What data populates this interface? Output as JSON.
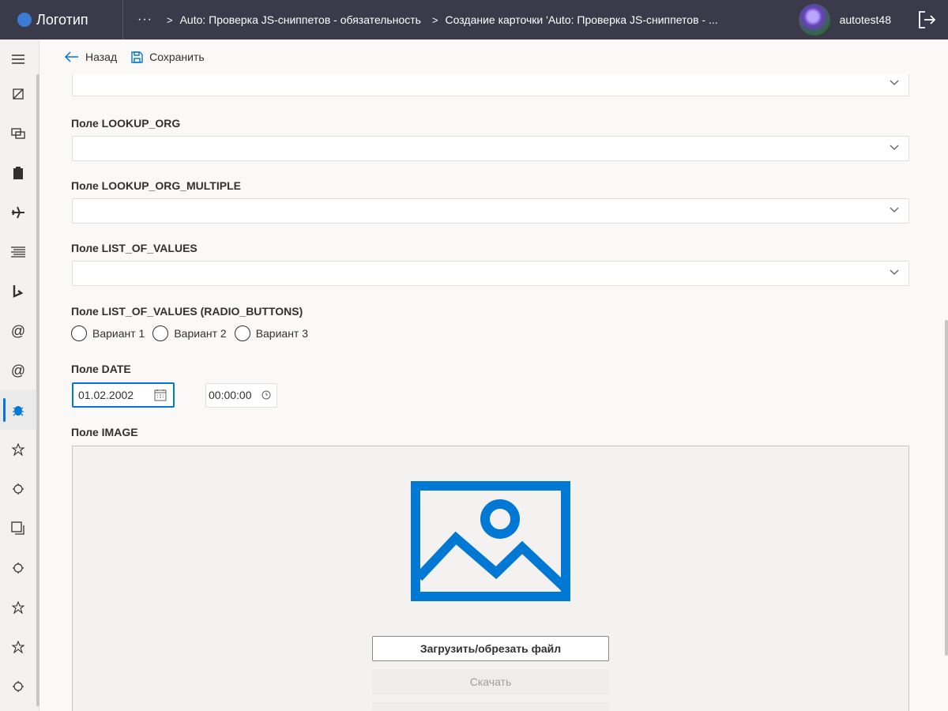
{
  "header": {
    "logo_text": "Логотип",
    "more": "···",
    "breadcrumbs": [
      "Auto: Проверка JS-сниппетов - обязательность",
      "Создание карточки 'Auto: Проверка JS-сниппетов - ..."
    ],
    "username": "autotest48"
  },
  "toolbar": {
    "back_label": "Назад",
    "save_label": "Сохранить"
  },
  "sidebar": {
    "icons": [
      "menu-icon",
      "document-icon",
      "chat-icon",
      "clipboard-icon",
      "airplane-icon",
      "list-icon",
      "bing-icon",
      "at-icon",
      "at-icon-2",
      "bug-icon",
      "star-icon",
      "gear-icon",
      "copy-icon",
      "gear-icon-2",
      "star-icon-2",
      "star-icon-3",
      "gear-icon-3"
    ],
    "active": "bug-icon"
  },
  "form": {
    "fields": {
      "lookup_org": "Поле LOOKUP_ORG",
      "lookup_org_multiple": "Поле LOOKUP_ORG_MULTIPLE",
      "list_of_values": "Поле LIST_OF_VALUES",
      "list_of_values_radio": "Поле LIST_OF_VALUES (RADIO_BUTTONS)",
      "date": "Поле DATE",
      "image": "Поле IMAGE"
    },
    "radio_options": [
      "Вариант 1",
      "Вариант 2",
      "Вариант 3"
    ],
    "date_value": "01.02.2002",
    "time_value": "00:00:00",
    "upload_label": "Загрузить/обрезать файл",
    "download_label": "Скачать"
  },
  "colors": {
    "topbar": "#3b3a4a",
    "accent": "#0078d4"
  }
}
